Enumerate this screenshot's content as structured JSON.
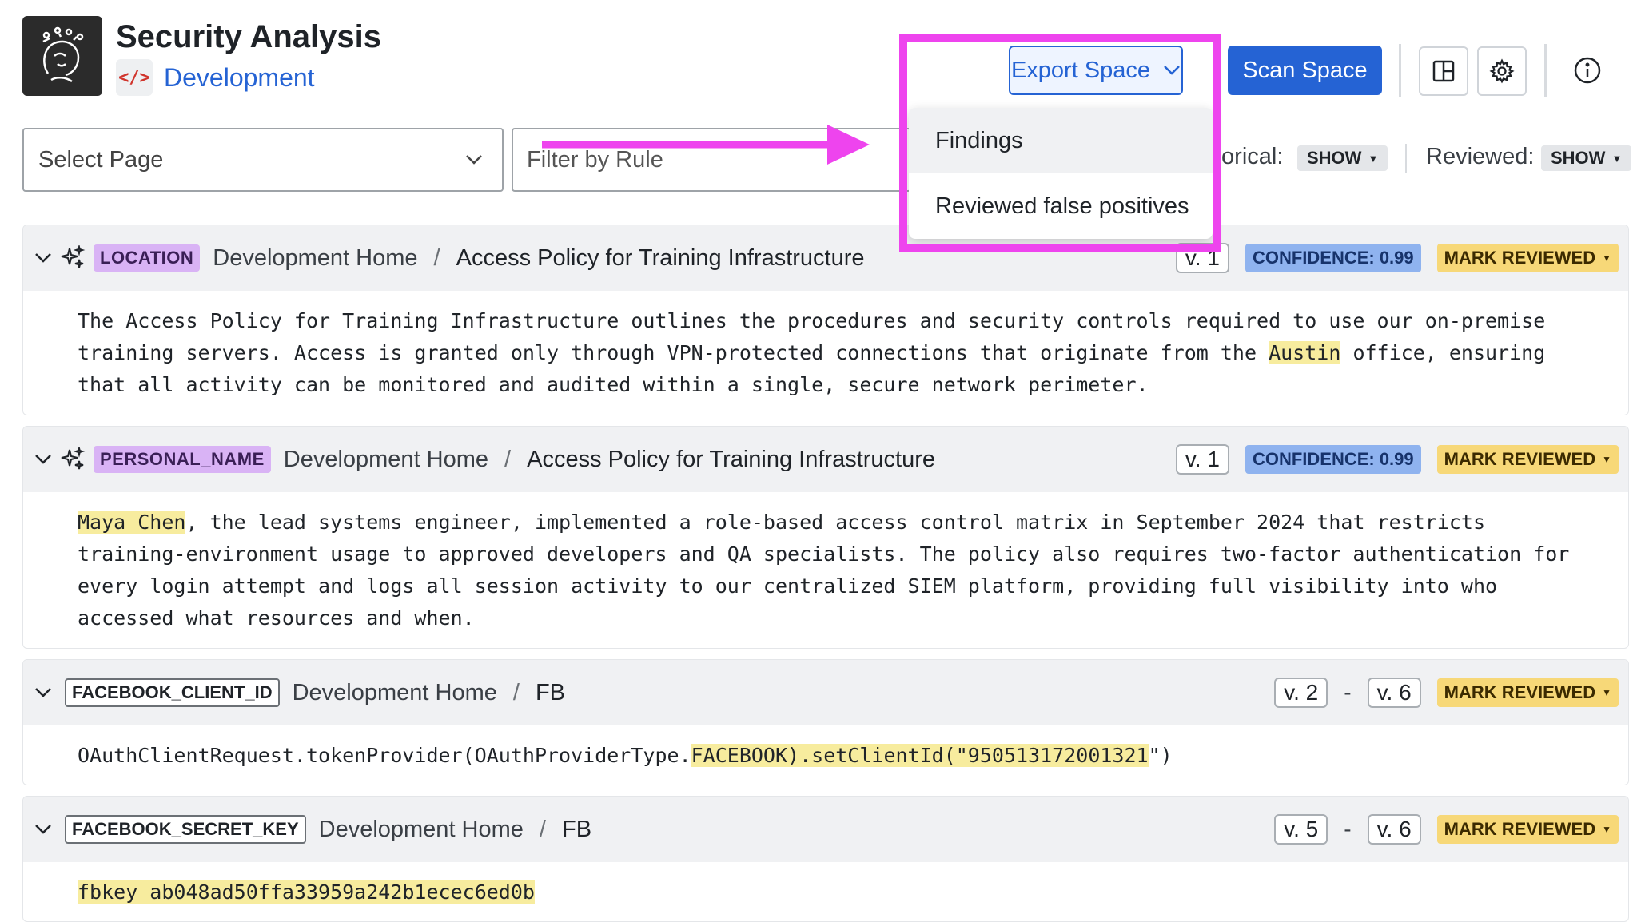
{
  "header": {
    "app_title": "Security Analysis",
    "space_icon_glyph": "</>",
    "space_name": "Development",
    "export_label": "Export Space",
    "scan_label": "Scan Space"
  },
  "filters": {
    "select_page_placeholder": "Select Page",
    "filter_rule_placeholder": "Filter by Rule",
    "historical_label": "torical:",
    "historical_value": "SHOW",
    "reviewed_label": "Reviewed:",
    "reviewed_value": "SHOW"
  },
  "export_menu": {
    "items": [
      "Findings",
      "Reviewed false positives"
    ]
  },
  "findings": [
    {
      "rule": "LOCATION",
      "space": "Development Home",
      "page": "Access Policy for Training Infrastructure",
      "version": "v. 1",
      "confidence": "CONFIDENCE: 0.99",
      "mark_label": "MARK REVIEWED",
      "text_before": "The Access Policy for Training Infrastructure outlines the procedures and security controls required to use our on-premise\ntraining servers. Access is granted only through VPN-protected connections that originate from the ",
      "match": "Austin",
      "text_after": " office, ensuring\nthat all activity can be monitored and audited within a single, secure network perimeter."
    },
    {
      "rule": "PERSONAL_NAME",
      "space": "Development Home",
      "page": "Access Policy for Training Infrastructure",
      "version": "v. 1",
      "confidence": "CONFIDENCE: 0.99",
      "mark_label": "MARK REVIEWED",
      "text_before": "",
      "match": "Maya Chen",
      "text_after": ", the lead systems engineer, implemented a role-based access control matrix in September 2024 that restricts\ntraining-environment usage to approved developers and QA specialists. The policy also requires two-factor authentication for\nevery login attempt and logs all session activity to our centralized SIEM platform, providing full visibility into who\naccessed what resources and when."
    },
    {
      "rule": "FACEBOOK_CLIENT_ID",
      "space": "Development Home",
      "page": "FB",
      "version_from": "v. 2",
      "version_to": "v. 6",
      "dash": "-",
      "mark_label": "MARK REVIEWED",
      "text_before": "OAuthClientRequest.tokenProvider(OAuthProviderType.",
      "match": "FACEBOOK).setClientId(\"950513172001321",
      "text_after": "\")"
    },
    {
      "rule": "FACEBOOK_SECRET_KEY",
      "space": "Development Home",
      "page": "FB",
      "version_from": "v. 5",
      "version_to": "v. 6",
      "dash": "-",
      "mark_label": "MARK REVIEWED",
      "text_before": "",
      "match": "fbkey ab048ad50ffa33959a242b1ecec6ed0b",
      "text_after": ""
    }
  ],
  "colors": {
    "accent": "#2563d4",
    "annotation": "#ee44ee",
    "match_highlight": "#f7ec9e",
    "confidence_badge": "#8fb3ef",
    "mark_badge": "#f7d878",
    "rule_tag": "#d9b3f5"
  }
}
